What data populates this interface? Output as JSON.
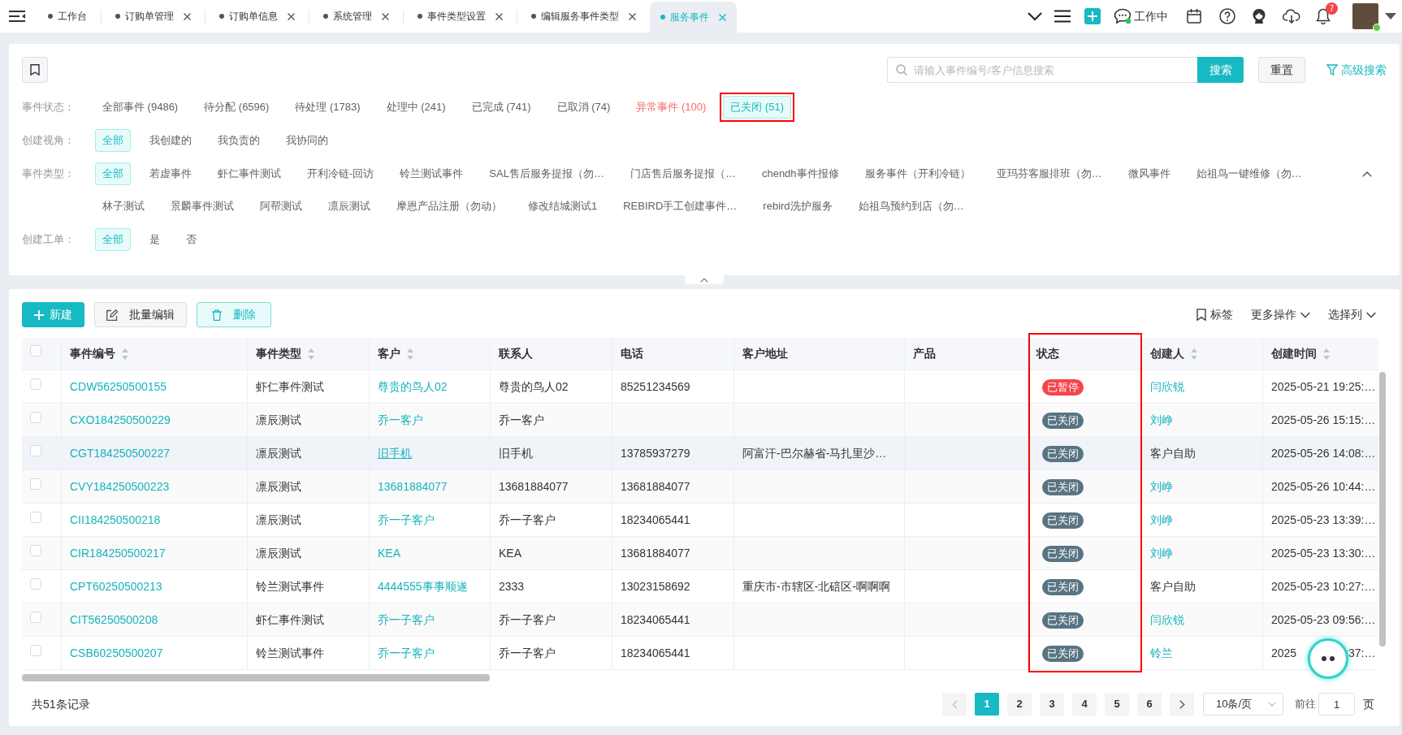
{
  "top_bar": {
    "tabs": [
      {
        "label": "工作台",
        "closable": false,
        "selected": false
      },
      {
        "label": "订购单管理",
        "closable": true,
        "selected": false
      },
      {
        "label": "订购单信息",
        "closable": true,
        "selected": false
      },
      {
        "label": "系统管理",
        "closable": true,
        "selected": false
      },
      {
        "label": "事件类型设置",
        "closable": true,
        "selected": false
      },
      {
        "label": "编辑服务事件类型",
        "closable": true,
        "selected": false
      },
      {
        "label": "服务事件",
        "closable": true,
        "selected": true
      }
    ],
    "work_status": {
      "label": "工作中",
      "online": true
    },
    "notifications": {
      "count": "7"
    },
    "user": {
      "online": true
    }
  },
  "search": {
    "placeholder": "请输入事件编号/客户信息搜索",
    "search_button": "搜索",
    "reset_button": "重置",
    "advanced_link": "高级搜索"
  },
  "filters": [
    {
      "label": "事件状态：",
      "lines": [
        [
          {
            "label": "全部事件 (9486)",
            "selected": false,
            "kind": "normal"
          },
          {
            "label": "待分配 (6596)",
            "selected": false,
            "kind": "normal"
          },
          {
            "label": "待处理 (1783)",
            "selected": false,
            "kind": "normal"
          },
          {
            "label": "处理中 (241)",
            "selected": false,
            "kind": "normal"
          },
          {
            "label": "已完成 (741)",
            "selected": false,
            "kind": "normal"
          },
          {
            "label": "已取消 (74)",
            "selected": false,
            "kind": "normal"
          },
          {
            "label": "异常事件 (100)",
            "selected": false,
            "kind": "alert"
          },
          {
            "label": "已关闭 (51)",
            "selected": true,
            "kind": "normal",
            "annotated": true
          }
        ]
      ]
    },
    {
      "label": "创建视角：",
      "lines": [
        [
          {
            "label": "全部",
            "selected": true
          },
          {
            "label": "我创建的",
            "selected": false
          },
          {
            "label": "我负责的",
            "selected": false
          },
          {
            "label": "我协同的",
            "selected": false
          }
        ]
      ]
    },
    {
      "label": "事件类型：",
      "expanded": true,
      "lines": [
        [
          {
            "label": "全部",
            "selected": true
          },
          {
            "label": "若虚事件",
            "selected": false
          },
          {
            "label": "虾仁事件测试",
            "selected": false
          },
          {
            "label": "开利冷链-回访",
            "selected": false
          },
          {
            "label": "铃兰测试事件",
            "selected": false
          },
          {
            "label": "SAL售后服务提报（勿…",
            "selected": false
          },
          {
            "label": "门店售后服务提报（…",
            "selected": false
          },
          {
            "label": "chendh事件报修",
            "selected": false
          },
          {
            "label": "服务事件（开利冷链）",
            "selected": false
          },
          {
            "label": "亚玛芬客服排班（勿…",
            "selected": false
          },
          {
            "label": "微风事件",
            "selected": false
          },
          {
            "label": "始祖鸟一键维修（勿…",
            "selected": false
          }
        ],
        [
          {
            "label": "林子测试",
            "selected": false
          },
          {
            "label": "景麟事件测试",
            "selected": false
          },
          {
            "label": "阿帮测试",
            "selected": false
          },
          {
            "label": "凛辰测试",
            "selected": false
          },
          {
            "label": "摩恩产品注册（勿动）",
            "selected": false
          },
          {
            "label": "修改结城测试1",
            "selected": false
          },
          {
            "label": "REBIRD手工创建事件…",
            "selected": false
          },
          {
            "label": "rebird洗护服务",
            "selected": false
          },
          {
            "label": "始祖鸟预约到店（勿…",
            "selected": false
          }
        ]
      ]
    },
    {
      "label": "创建工单：",
      "lines": [
        [
          {
            "label": "全部",
            "selected": true
          },
          {
            "label": "是",
            "selected": false
          },
          {
            "label": "否",
            "selected": false
          }
        ]
      ]
    }
  ],
  "table": {
    "actions": [
      {
        "label": "新建",
        "kind": "create"
      },
      {
        "label": "批量编辑",
        "kind": "edit"
      },
      {
        "label": "删除",
        "kind": "delete"
      }
    ],
    "tools": [
      {
        "label": "标签",
        "kind": "tag"
      },
      {
        "label": "更多操作",
        "kind": "menu"
      },
      {
        "label": "选择列",
        "kind": "menu"
      }
    ],
    "all_checked": false,
    "columns": [
      {
        "label": "事件编号",
        "sortable": true
      },
      {
        "label": "事件类型",
        "sortable": true
      },
      {
        "label": "客户",
        "sortable": true
      },
      {
        "label": "联系人"
      },
      {
        "label": "电话"
      },
      {
        "label": "客户地址"
      },
      {
        "label": "产品"
      },
      {
        "label": "状态",
        "annotated": true
      },
      {
        "label": "创建人",
        "sortable": true
      },
      {
        "label": "创建时间",
        "sortable": true
      }
    ],
    "rows": [
      {
        "checked": false,
        "hovered": false,
        "event_no": "CDW56250500155",
        "event_type": "虾仁事件测试",
        "customer": "尊贵的鸟人02",
        "contact": "尊贵的鸟人02",
        "phone": "85251234569",
        "status": {
          "label": "已暂停",
          "color": "#f5454b"
        },
        "creator": "闫欣锐",
        "creator_link": true,
        "created": "2025-05-21 19:25:…"
      },
      {
        "checked": false,
        "hovered": false,
        "event_no": "CXO184250500229",
        "event_type": "凛辰测试",
        "customer": "乔一客户",
        "contact": "乔一客户",
        "status": {
          "label": "已关闭",
          "color": "#587482"
        },
        "creator": "刘峥",
        "creator_link": true,
        "created": "2025-05-26 15:15:…"
      },
      {
        "checked": false,
        "hovered": true,
        "event_no": "CGT184250500227",
        "event_type": "凛辰测试",
        "customer": "旧手机",
        "contact": "旧手机",
        "phone": "13785937279",
        "address": "阿富汗-巴尔赫省-马扎里沙…",
        "status": {
          "label": "已关闭",
          "color": "#587482"
        },
        "creator": "客户自助",
        "creator_link": false,
        "created": "2025-05-26 14:08:…"
      },
      {
        "checked": false,
        "hovered": false,
        "event_no": "CVY184250500223",
        "event_type": "凛辰测试",
        "customer": "13681884077",
        "contact": "13681884077",
        "phone": "13681884077",
        "status": {
          "label": "已关闭",
          "color": "#587482"
        },
        "creator": "刘峥",
        "creator_link": true,
        "created": "2025-05-26 10:44:…"
      },
      {
        "checked": false,
        "hovered": false,
        "event_no": "CII184250500218",
        "event_type": "凛辰测试",
        "customer": "乔一子客户",
        "contact": "乔一子客户",
        "phone": "18234065441",
        "status": {
          "label": "已关闭",
          "color": "#587482"
        },
        "creator": "刘峥",
        "creator_link": true,
        "created": "2025-05-23 13:39:…"
      },
      {
        "checked": false,
        "hovered": false,
        "event_no": "CIR184250500217",
        "event_type": "凛辰测试",
        "customer": "KEA",
        "contact": "KEA",
        "phone": "13681884077",
        "status": {
          "label": "已关闭",
          "color": "#587482"
        },
        "creator": "刘峥",
        "creator_link": true,
        "created": "2025-05-23 13:30:…"
      },
      {
        "checked": false,
        "hovered": false,
        "event_no": "CPT60250500213",
        "event_type": "铃兰测试事件",
        "customer": "4444555事事顺遂",
        "contact": "2333",
        "phone": "13023158692",
        "address": "重庆市-市辖区-北碚区-啊啊啊",
        "status": {
          "label": "已关闭",
          "color": "#587482"
        },
        "creator": "客户自助",
        "creator_link": false,
        "created": "2025-05-23 10:27:…"
      },
      {
        "checked": false,
        "hovered": false,
        "event_no": "CIT56250500208",
        "event_type": "虾仁事件测试",
        "customer": "乔一子客户",
        "contact": "乔一子客户",
        "phone": "18234065441",
        "status": {
          "label": "已关闭",
          "color": "#587482"
        },
        "creator": "闫欣锐",
        "creator_link": true,
        "created": "2025-05-23 09:56:…"
      },
      {
        "checked": false,
        "hovered": false,
        "event_no": "CSB60250500207",
        "event_type": "铃兰测试事件",
        "customer": "乔一子客户",
        "contact": "乔一子客户",
        "phone": "18234065441",
        "status": {
          "label": "已关闭",
          "color": "#587482"
        },
        "creator": "铃兰",
        "creator_link": true,
        "created": "2025",
        "created_tail": ":37:…"
      }
    ],
    "footer": {
      "total": "共51条记录",
      "prev_disabled": true,
      "next_disabled": false,
      "pages": [
        {
          "label": "1",
          "selected": true
        },
        {
          "label": "2",
          "selected": false
        },
        {
          "label": "3",
          "selected": false
        },
        {
          "label": "4",
          "selected": false
        },
        {
          "label": "5",
          "selected": false
        },
        {
          "label": "6",
          "selected": false
        }
      ],
      "page_size": "10条/页",
      "goto_label": "前往",
      "goto_value": "1",
      "goto_suffix": "页"
    }
  }
}
